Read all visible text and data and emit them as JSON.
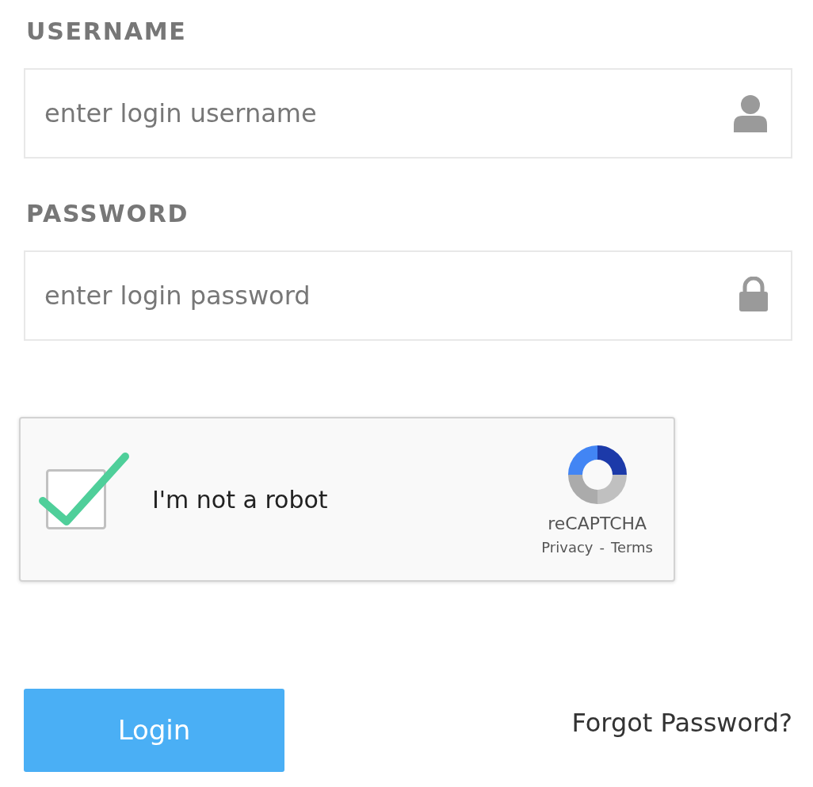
{
  "fields": [
    {
      "label": "USERNAME",
      "placeholder": "enter login username",
      "kind": "user"
    },
    {
      "label": "PASSWORD",
      "placeholder": "enter login password",
      "kind": "lock"
    }
  ],
  "captcha": {
    "label": "I'm not a robot",
    "checked": true,
    "brand": "reCAPTCHA",
    "privacy": "Privacy",
    "separator": "-",
    "terms": "Terms"
  },
  "login_button": "Login",
  "forgot_link": "Forgot Password?"
}
